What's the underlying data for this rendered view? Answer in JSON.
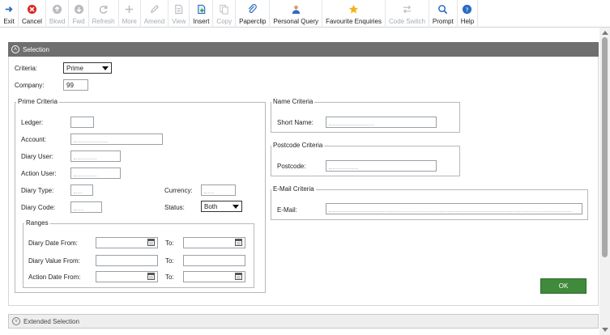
{
  "toolbar": {
    "buttons": [
      {
        "label": "Exit",
        "icon": "exit-icon",
        "enabled": true
      },
      {
        "label": "Cancel",
        "icon": "cancel-icon",
        "enabled": true
      },
      {
        "label": "Bkwd",
        "icon": "backward-icon",
        "enabled": false
      },
      {
        "label": "Fwd",
        "icon": "forward-icon",
        "enabled": false
      },
      {
        "label": "Refresh",
        "icon": "refresh-icon",
        "enabled": false
      },
      {
        "label": "More",
        "icon": "plus-icon",
        "enabled": false
      },
      {
        "label": "Amend",
        "icon": "pencil-icon",
        "enabled": false
      },
      {
        "label": "View",
        "icon": "document-icon",
        "enabled": false
      },
      {
        "label": "Insert",
        "icon": "insert-document-icon",
        "enabled": true
      },
      {
        "label": "Copy",
        "icon": "copy-icon",
        "enabled": false
      },
      {
        "label": "Paperclip",
        "icon": "paperclip-icon",
        "enabled": true
      },
      {
        "label": "Personal Query",
        "icon": "person-icon",
        "enabled": true
      },
      {
        "label": "Favourite Enquiries",
        "icon": "star-icon",
        "enabled": true
      },
      {
        "label": "Code Switch",
        "icon": "switch-arrows-icon",
        "enabled": false
      },
      {
        "label": "Prompt",
        "icon": "magnifier-icon",
        "enabled": true
      },
      {
        "label": "Help",
        "icon": "help-icon",
        "enabled": true
      }
    ]
  },
  "selection": {
    "title": "Selection",
    "criteria_label": "Criteria:",
    "criteria_value": "Prime",
    "company_label": "Company:",
    "company_value": "99"
  },
  "prime": {
    "title": "Prime Criteria",
    "ledger_label": "Ledger:",
    "account_label": "Account:",
    "diary_user_label": "Diary User:",
    "action_user_label": "Action User:",
    "diary_type_label": "Diary Type:",
    "diary_code_label": "Diary Code:",
    "currency_label": "Currency:",
    "status_label": "Status:",
    "status_value": "Both"
  },
  "ranges": {
    "title": "Ranges",
    "diary_date_from_label": "Diary Date From:",
    "diary_value_from_label": "Diary Value From:",
    "action_date_from_label": "Action Date From:",
    "to_label": "To:"
  },
  "name_criteria": {
    "title": "Name Criteria",
    "short_name_label": "Short Name:"
  },
  "postcode_criteria": {
    "title": "Postcode Criteria",
    "postcode_label": "Postcode:"
  },
  "email_criteria": {
    "title": "E-Mail Criteria",
    "email_label": "E-Mail:"
  },
  "ok_label": "OK",
  "extended": {
    "title": "Extended Selection"
  },
  "colors": {
    "ok_green": "#3f8a3b",
    "header_grey": "#6f6f6f"
  }
}
